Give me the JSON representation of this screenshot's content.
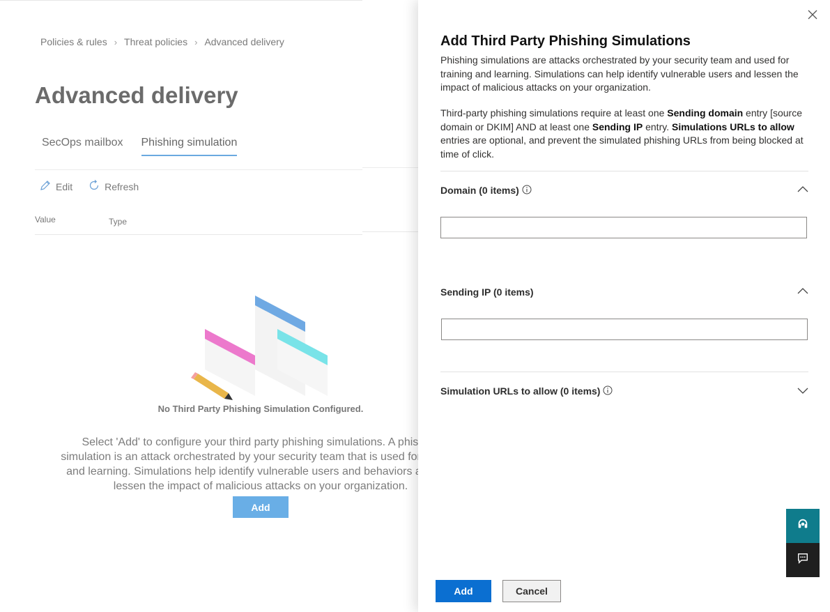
{
  "breadcrumb": [
    "Policies & rules",
    "Threat policies",
    "Advanced delivery"
  ],
  "page": {
    "title": "Advanced delivery"
  },
  "tabs": [
    {
      "label": "SecOps mailbox",
      "active": false
    },
    {
      "label": "Phishing simulation",
      "active": true
    }
  ],
  "commands": {
    "edit": "Edit",
    "refresh": "Refresh"
  },
  "columns": {
    "value": "Value",
    "type": "Type"
  },
  "empty_state": {
    "title": "No Third Party Phishing Simulation Configured.",
    "description": "Select 'Add' to configure your third party phishing simulations. A phishing simulation is an attack orchestrated by your security team that is used for training and learning. Simulations help identify vulnerable users and behaviors and can lessen the impact of malicious attacks on your organization.",
    "add_label": "Add"
  },
  "panel": {
    "title": "Add Third Party Phishing Simulations",
    "description": "Phishing simulations are attacks orchestrated by your security team and used for training and learning. Simulations can help identify vulnerable users and lessen the impact of malicious attacks on your organization.",
    "req": {
      "t1": "Third-party phishing simulations require at least one ",
      "b1": "Sending domain",
      "t2": " entry [source domain or DKIM] AND at least one ",
      "b2": "Sending IP",
      "t3": " entry. ",
      "b3": "Simulations URLs to allow",
      "t4": " entries are optional, and prevent the simulated phishing URLs from being blocked at time of click."
    },
    "sections": {
      "domain": {
        "label": "Domain (0 items)",
        "expanded": true,
        "value": ""
      },
      "sending_ip": {
        "label": "Sending IP (0 items)",
        "expanded": true,
        "value": ""
      },
      "urls": {
        "label": "Simulation URLs to allow (0 items)",
        "expanded": false
      }
    },
    "add_label": "Add",
    "cancel_label": "Cancel"
  },
  "colors": {
    "accent": "#0b6fd1",
    "teal": "#0f7c8c",
    "dark": "#1f1f1f"
  }
}
